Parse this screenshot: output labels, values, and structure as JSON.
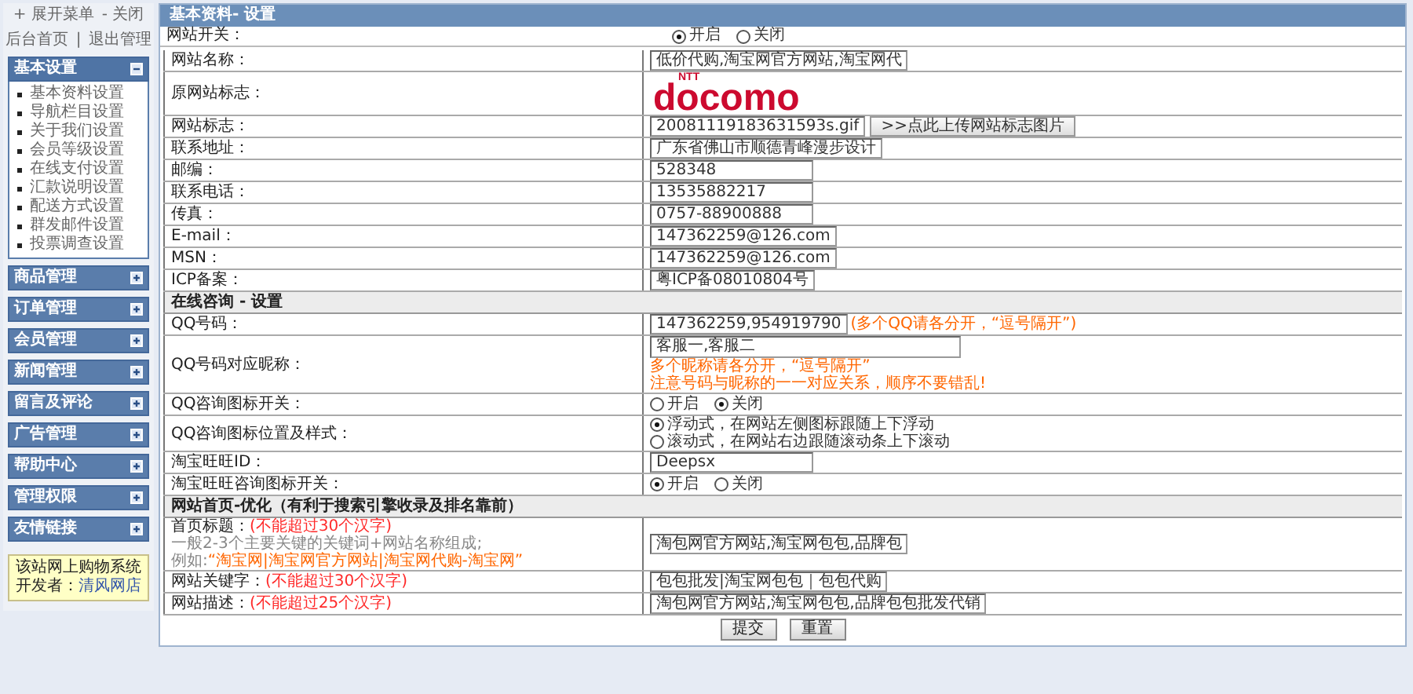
{
  "sidebar": {
    "menu_toggles": [
      "+ 展开菜单",
      "- 关闭"
    ],
    "admin_links": [
      "后台首页",
      "退出管理"
    ],
    "admin_links_separator": "|",
    "sections": [
      {
        "title": "基本设置",
        "expanded": true,
        "items": [
          "基本资料设置",
          "导航栏目设置",
          "关于我们设置",
          "会员等级设置",
          "在线支付设置",
          "汇款说明设置",
          "配送方式设置",
          "群发邮件设置",
          "投票调查设置"
        ]
      },
      {
        "title": "商品管理",
        "expanded": false
      },
      {
        "title": "订单管理",
        "expanded": false
      },
      {
        "title": "会员管理",
        "expanded": false
      },
      {
        "title": "新闻管理",
        "expanded": false
      },
      {
        "title": "留言及评论",
        "expanded": false
      },
      {
        "title": "广告管理",
        "expanded": false
      },
      {
        "title": "帮助中心",
        "expanded": false
      },
      {
        "title": "管理权限",
        "expanded": false
      },
      {
        "title": "友情链接",
        "expanded": false
      }
    ],
    "notice_text": "该站网上购物系统开发者：",
    "notice_link": "清风网店"
  },
  "panel": {
    "title": "基本资料- 设置",
    "site_switch": {
      "label": "网站开关：",
      "options": [
        {
          "label": "开启",
          "selected": true
        },
        {
          "label": "关闭",
          "selected": false
        }
      ]
    },
    "rows": [
      {
        "kind": "text",
        "label": "网站名称：",
        "value": "低价代购,淘宝网官方网站,淘宝网代"
      },
      {
        "kind": "logo",
        "label": "原网站标志：",
        "logo_tagline": "NTT",
        "logo_wordmark": "docomo"
      },
      {
        "kind": "upload",
        "label": "网站标志：",
        "value": "20081119183631593s.gif",
        "button": ">>点此上传网站标志图片"
      },
      {
        "kind": "text",
        "label": "联系地址：",
        "value": "广东省佛山市顺德青峰漫步设计"
      },
      {
        "kind": "text",
        "label": "邮编：",
        "value": "528348"
      },
      {
        "kind": "text",
        "label": "联系电话：",
        "value": "13535882217"
      },
      {
        "kind": "text",
        "label": "传真：",
        "value": "0757-88900888"
      },
      {
        "kind": "text",
        "label": "E-mail：",
        "value": "147362259@126.com"
      },
      {
        "kind": "text",
        "label": "MSN：",
        "value": "147362259@126.com"
      },
      {
        "kind": "text",
        "label": "ICP备案：",
        "value": "粤ICP备08010804号"
      },
      {
        "kind": "heading",
        "label": "在线咨询 - 设置"
      },
      {
        "kind": "text",
        "label": "QQ号码：",
        "value": "147362259,954919790",
        "note": "(多个QQ请各分开，“逗号隔开”)"
      },
      {
        "kind": "textarea",
        "label": "QQ号码对应昵称：",
        "value": "客服一,客服二",
        "notes": [
          "多个昵称请各分开，“逗号隔开”",
          "注意号码与昵称的一一对应关系，顺序不要错乱!"
        ]
      },
      {
        "kind": "radio",
        "label": "QQ咨询图标开关：",
        "options": [
          {
            "label": "开启",
            "selected": false
          },
          {
            "label": "关闭",
            "selected": true
          }
        ]
      },
      {
        "kind": "radio_list",
        "label": "QQ咨询图标位置及样式：",
        "options": [
          {
            "label": "浮动式，在网站左侧图标跟随上下浮动",
            "selected": true
          },
          {
            "label": "滚动式，在网站右边跟随滚动条上下滚动",
            "selected": false
          }
        ]
      },
      {
        "kind": "text",
        "label": "淘宝旺旺ID：",
        "value": "Deepsx"
      },
      {
        "kind": "radio",
        "label": "淘宝旺旺咨询图标开关：",
        "options": [
          {
            "label": "开启",
            "selected": true
          },
          {
            "label": "关闭",
            "selected": false
          }
        ]
      },
      {
        "kind": "heading",
        "label": "网站首页-优化（有利于搜索引擎收录及排名靠前）"
      },
      {
        "kind": "text",
        "label": "首页标题：",
        "limit": "(不能超过30个汉字)",
        "help": "一般2-3个主要关键的关键词+网站名称组成;",
        "example_prefix": "例如:",
        "example": "“淘宝网|淘宝网官方网站|淘宝网代购-淘宝网”",
        "value": "淘包网官方网站,淘宝网包包,品牌包"
      },
      {
        "kind": "text",
        "label": "网站关键字：",
        "limit": "(不能超过30个汉字)",
        "value": "包包批发|淘宝网包包｜包包代购"
      },
      {
        "kind": "text",
        "label": "网站描述：",
        "limit": "(不能超过25个汉字)",
        "value": "淘包网官方网站,淘宝网包包,品牌包包批发代销"
      }
    ],
    "buttons": [
      "提交",
      "重置"
    ]
  }
}
